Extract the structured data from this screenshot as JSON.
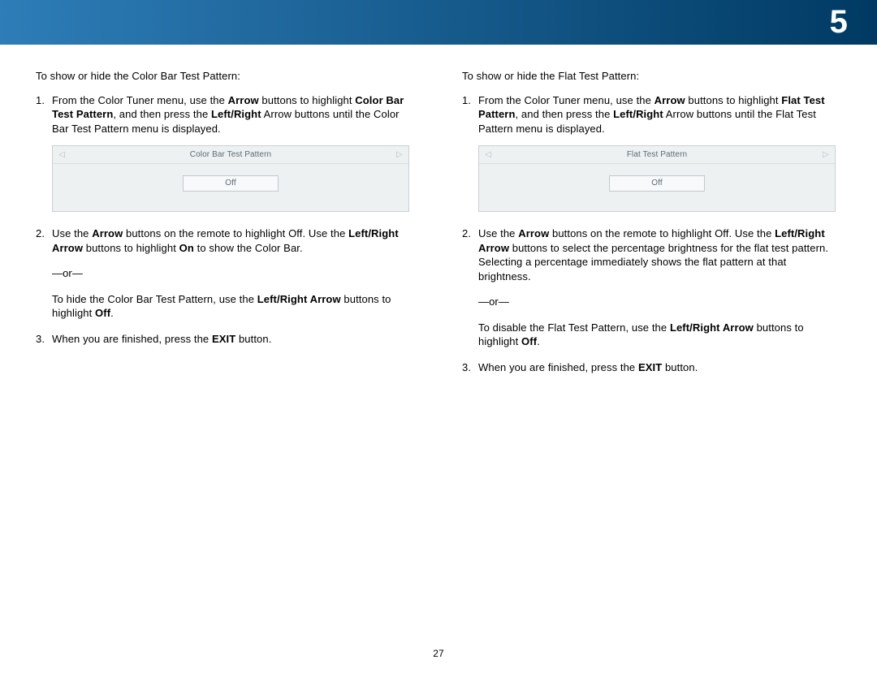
{
  "header": {
    "chapter_number": "5"
  },
  "page_number": "27",
  "left": {
    "intro": "To show or hide the Color Bar Test Pattern:",
    "step1_a": "From the Color Tuner menu, use the ",
    "step1_b": "Arrow",
    "step1_c": " buttons to highlight ",
    "step1_d": "Color Bar Test Pattern",
    "step1_e": ", and then press the ",
    "step1_f": "Left/Right",
    "step1_g": " Arrow buttons until the Color Bar Test Pattern menu is displayed.",
    "menu": {
      "title": "Color Bar Test Pattern",
      "value": "Off"
    },
    "step2_a": "Use the ",
    "step2_b": "Arrow",
    "step2_c": " buttons on the remote to highlight Off. Use the ",
    "step2_d": "Left/Right Arrow",
    "step2_e": " buttons to highlight ",
    "step2_f": "On",
    "step2_g": " to show the Color Bar.",
    "or": "—or—",
    "step2h_a": "To hide the Color Bar Test Pattern, use the ",
    "step2h_b": "Left/Right Arrow",
    "step2h_c": " buttons to highlight ",
    "step2h_d": "Off",
    "step2h_e": ".",
    "step3_a": "When you are finished, press the ",
    "step3_b": "EXIT",
    "step3_c": " button."
  },
  "right": {
    "intro": "To show or hide the Flat Test Pattern:",
    "step1_a": "From the Color Tuner menu, use the ",
    "step1_b": "Arrow",
    "step1_c": " buttons to highlight ",
    "step1_d": "Flat Test Pattern",
    "step1_e": ", and then press the ",
    "step1_f": "Left/Right",
    "step1_g": " Arrow buttons until the Flat Test Pattern menu is displayed.",
    "menu": {
      "title": "Flat Test Pattern",
      "value": "Off"
    },
    "step2_a": "Use the ",
    "step2_b": "Arrow",
    "step2_c": " buttons on the remote to highlight Off. Use the ",
    "step2_d": "Left/Right Arrow",
    "step2_e": " buttons to select the percentage brightness for the flat test pattern. Selecting a percentage immediately shows the flat pattern at that brightness.",
    "or": "—or—",
    "step2h_a": "To disable the Flat Test Pattern, use the ",
    "step2h_b": "Left/Right Arrow",
    "step2h_c": " buttons to highlight ",
    "step2h_d": "Off",
    "step2h_e": ".",
    "step3_a": "When you are finished, press the ",
    "step3_b": "EXIT",
    "step3_c": " button."
  }
}
